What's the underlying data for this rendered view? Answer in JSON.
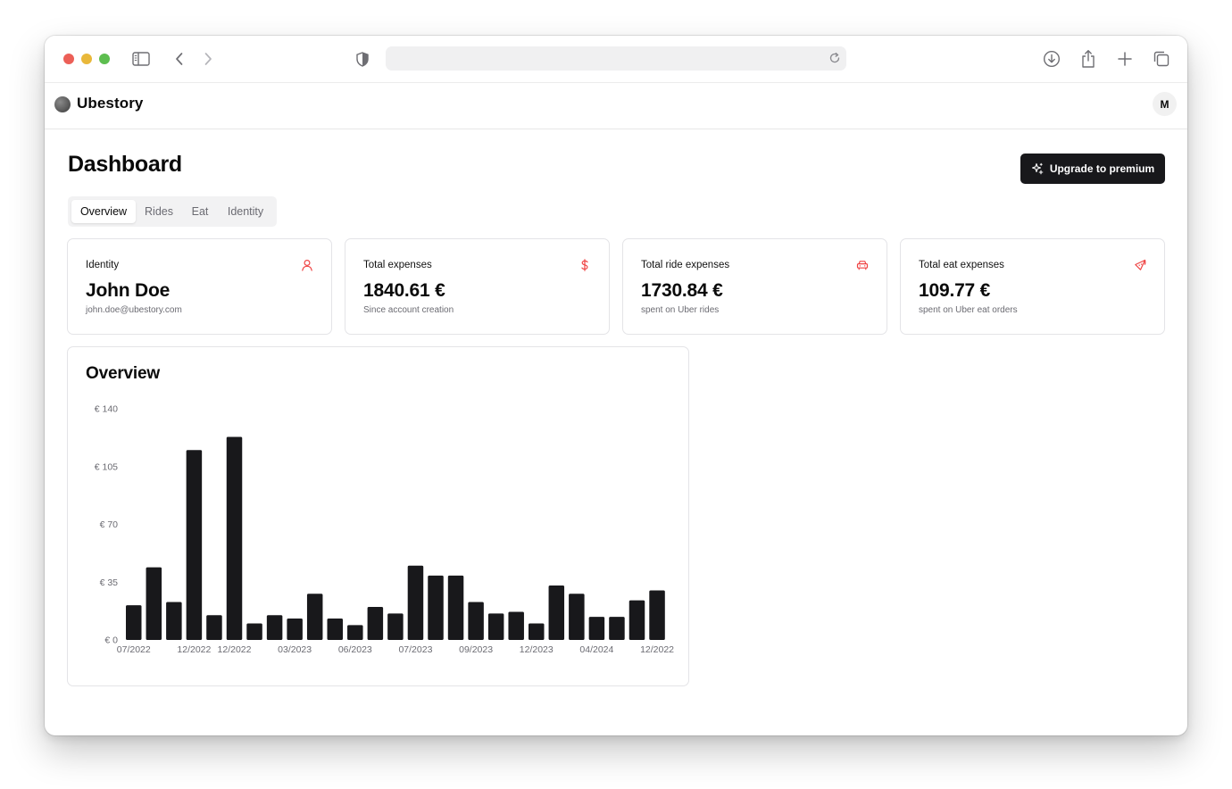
{
  "browser": {
    "icons": [
      "sidebar-icon",
      "back-icon",
      "forward-icon",
      "shield-icon",
      "reload-icon",
      "download-icon",
      "share-icon",
      "new-tab-icon",
      "tabs-overview-icon"
    ],
    "url": ""
  },
  "app": {
    "brand": "Ubestory",
    "avatar_initial": "M"
  },
  "page": {
    "title": "Dashboard",
    "upgrade_label": "Upgrade to premium",
    "tabs": [
      "Overview",
      "Rides",
      "Eat",
      "Identity"
    ],
    "active_tab": "Overview"
  },
  "cards": [
    {
      "label": "Identity",
      "value": "John Doe",
      "sub": "john.doe@ubestory.com",
      "icon": "user-icon"
    },
    {
      "label": "Total expenses",
      "value": "1840.61 €",
      "sub": "Since account creation",
      "icon": "dollar-icon"
    },
    {
      "label": "Total ride expenses",
      "value": "1730.84 €",
      "sub": "spent on Uber rides",
      "icon": "car-icon"
    },
    {
      "label": "Total eat expenses",
      "value": "109.77 €",
      "sub": "spent on Uber eat orders",
      "icon": "pizza-icon"
    }
  ],
  "colors": {
    "accent": "#ef4444",
    "bar": "#18181b",
    "primary_button": "#18181b"
  },
  "overview": {
    "title": "Overview"
  },
  "chart_data": {
    "type": "bar",
    "title": "",
    "xlabel": "",
    "ylabel": "",
    "ylim": [
      0,
      140
    ],
    "yticks": [
      "€ 0",
      "€ 35",
      "€ 70",
      "€ 105",
      "€ 140"
    ],
    "ytick_values": [
      0,
      35,
      70,
      105,
      140
    ],
    "xtick_labels": [
      "07/2022",
      "12/2022",
      "12/2022",
      "03/2023",
      "06/2023",
      "07/2023",
      "09/2023",
      "12/2023",
      "04/2024",
      "12/2022"
    ],
    "xtick_bar_index": [
      0,
      3,
      5,
      8,
      11,
      14,
      17,
      20,
      23,
      26
    ],
    "values": [
      21,
      44,
      23,
      115,
      15,
      123,
      10,
      15,
      13,
      28,
      13,
      9,
      20,
      16,
      45,
      39,
      39,
      23,
      16,
      17,
      10,
      33,
      28,
      14,
      14,
      24,
      30
    ],
    "grid": false,
    "legend": "none"
  }
}
